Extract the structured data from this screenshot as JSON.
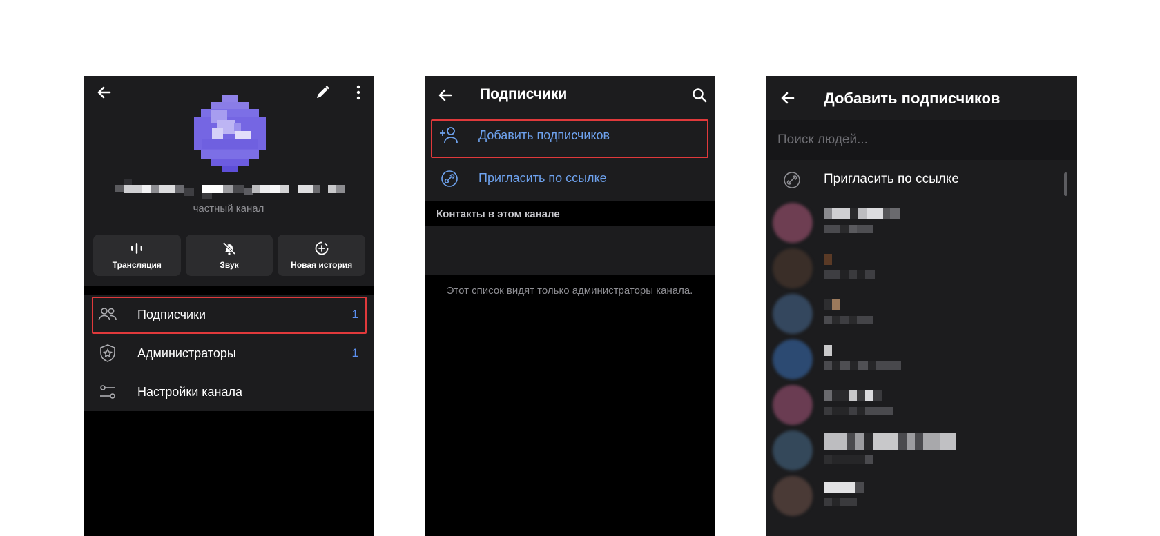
{
  "panel_channel": {
    "back_icon": "arrow-left-icon",
    "edit_icon": "pencil-icon",
    "more_icon": "more-vertical-icon",
    "subtitle": "частный канал",
    "actions": [
      {
        "label": "Трансляция",
        "icon": "broadcast-icon"
      },
      {
        "label": "Звук",
        "icon": "bell-off-icon"
      },
      {
        "label": "Новая история",
        "icon": "add-story-icon"
      }
    ],
    "menu": [
      {
        "label": "Подписчики",
        "count": "1",
        "icon": "people-icon"
      },
      {
        "label": "Администраторы",
        "count": "1",
        "icon": "shield-star-icon"
      },
      {
        "label": "Настройки канала",
        "count": "",
        "icon": "sliders-icon"
      }
    ]
  },
  "panel_subscribers": {
    "title": "Подписчики",
    "add_label": "Добавить подписчиков",
    "invite_label": "Пригласить по ссылке",
    "section_title": "Контакты в этом канале",
    "note": "Этот список видят только администраторы канала."
  },
  "panel_add": {
    "title": "Добавить подписчиков",
    "search_placeholder": "Поиск людей...",
    "invite_label": "Пригласить по ссылке"
  },
  "colors": {
    "accent": "#6ea2ee",
    "highlight": "#e0393b",
    "avatar": "#7b6be6"
  }
}
